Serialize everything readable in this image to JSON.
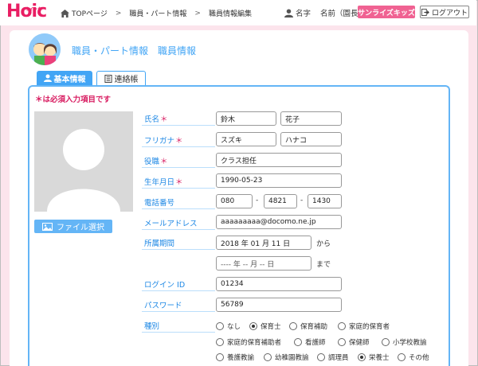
{
  "app": {
    "logo": "Hoic",
    "logo_small": "ホイック"
  },
  "breadcrumb": [
    "TOPページ",
    "職員・パート情報",
    "職員情報編集"
  ],
  "header": {
    "user_label": "名字",
    "user_name": "名前（園長）",
    "school_button": "サンライズキッズ",
    "logout_button": "ログアウト"
  },
  "page": {
    "title": "職員・パート情報　職員情報",
    "tabs": [
      {
        "label": "基本情報",
        "active": true,
        "icon": "person-icon"
      },
      {
        "label": "連絡帳",
        "active": false,
        "icon": "notebook-icon"
      }
    ],
    "required_note": "＊は必須入力項目です",
    "file_button": "ファイル選択"
  },
  "form": {
    "name": {
      "label": "氏名",
      "required": "＊",
      "last": "鈴木",
      "first": "花子"
    },
    "furigana": {
      "label": "フリガナ",
      "required": "＊",
      "last": "スズキ",
      "first": "ハナコ"
    },
    "role": {
      "label": "役職",
      "required": "＊",
      "value": "クラス担任"
    },
    "birthday": {
      "label": "生年月日",
      "required": "＊",
      "value": "1990-05-23"
    },
    "phone": {
      "label": "電話番号",
      "parts": [
        "080",
        "4821",
        "1430"
      ],
      "sep": "-"
    },
    "email": {
      "label": "メールアドレス",
      "value": "aaaaaaaaa@docomo.ne.jp"
    },
    "period": {
      "label": "所属期間",
      "from": "2018 年 01 月 11 日",
      "from_suffix": "から",
      "to": "---- 年 -- 月 -- 日",
      "to_suffix": "まで"
    },
    "login_id": {
      "label": "ログイン ID",
      "value": "01234"
    },
    "password": {
      "label": "パスワード",
      "value": "56789"
    },
    "type": {
      "label": "種別",
      "options": [
        "なし",
        "保育士",
        "保育補助",
        "家庭的保育者",
        "家庭的保育補助者",
        "看護師",
        "保健師",
        "小学校教諭",
        "養護教諭",
        "幼稚園教諭",
        "調理員",
        "栄養士",
        "その他"
      ],
      "selected": [
        "保育士",
        "栄養士"
      ]
    }
  },
  "colors": {
    "accent": "#42a5f5",
    "pink": "#f06292",
    "required": "#d81b60"
  }
}
